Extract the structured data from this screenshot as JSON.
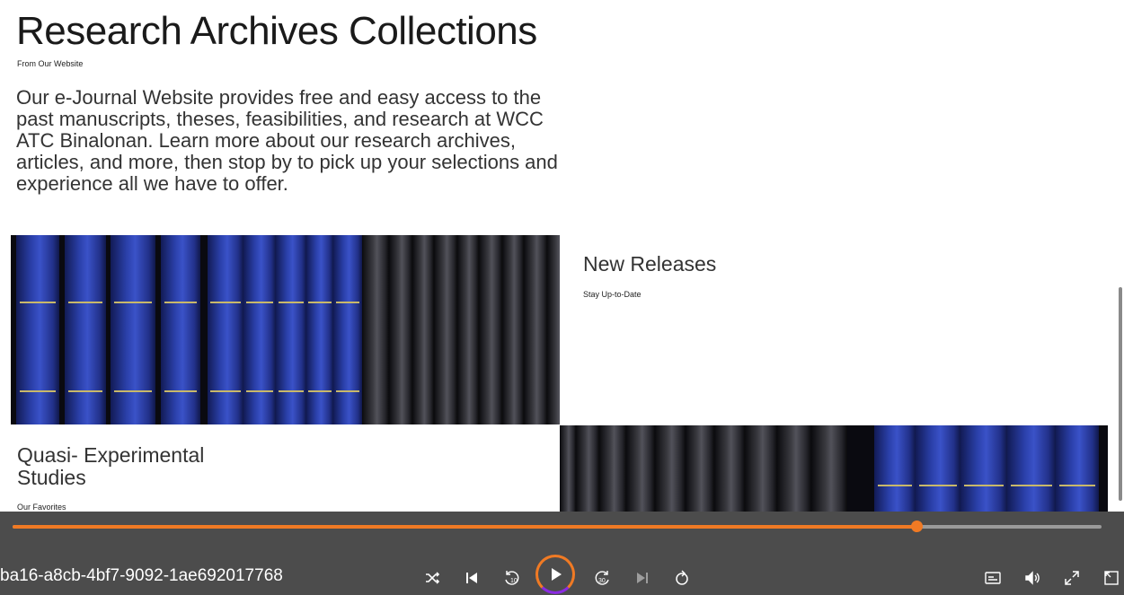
{
  "page": {
    "title": "Research Archives Collections",
    "title_sub": "From Our Website",
    "intro": "Our e-Journal Website provides free and easy access to the past manuscripts, theses, feasibilities, and research at WCC ATC Binalonan. Learn more about our research archives, articles, and more, then stop by to pick up your selections and experience all we have to offer."
  },
  "new_releases": {
    "title": "New Releases",
    "sub": "Stay Up-to-Date"
  },
  "quasi": {
    "title": "Quasi- Experimental Studies",
    "sub": "Our Favorites"
  },
  "player": {
    "video_id": "ba16-a8cb-4bf7-9092-1ae692017768",
    "progress": 0.83,
    "accent_color": "#f07a24",
    "controls": [
      "shuffle-icon",
      "previous-icon",
      "rewind-10-icon",
      "play-icon",
      "forward-30-icon",
      "next-icon",
      "loop-icon",
      "captions-icon",
      "volume-icon",
      "fullscreen-icon",
      "mini-player-icon"
    ]
  }
}
